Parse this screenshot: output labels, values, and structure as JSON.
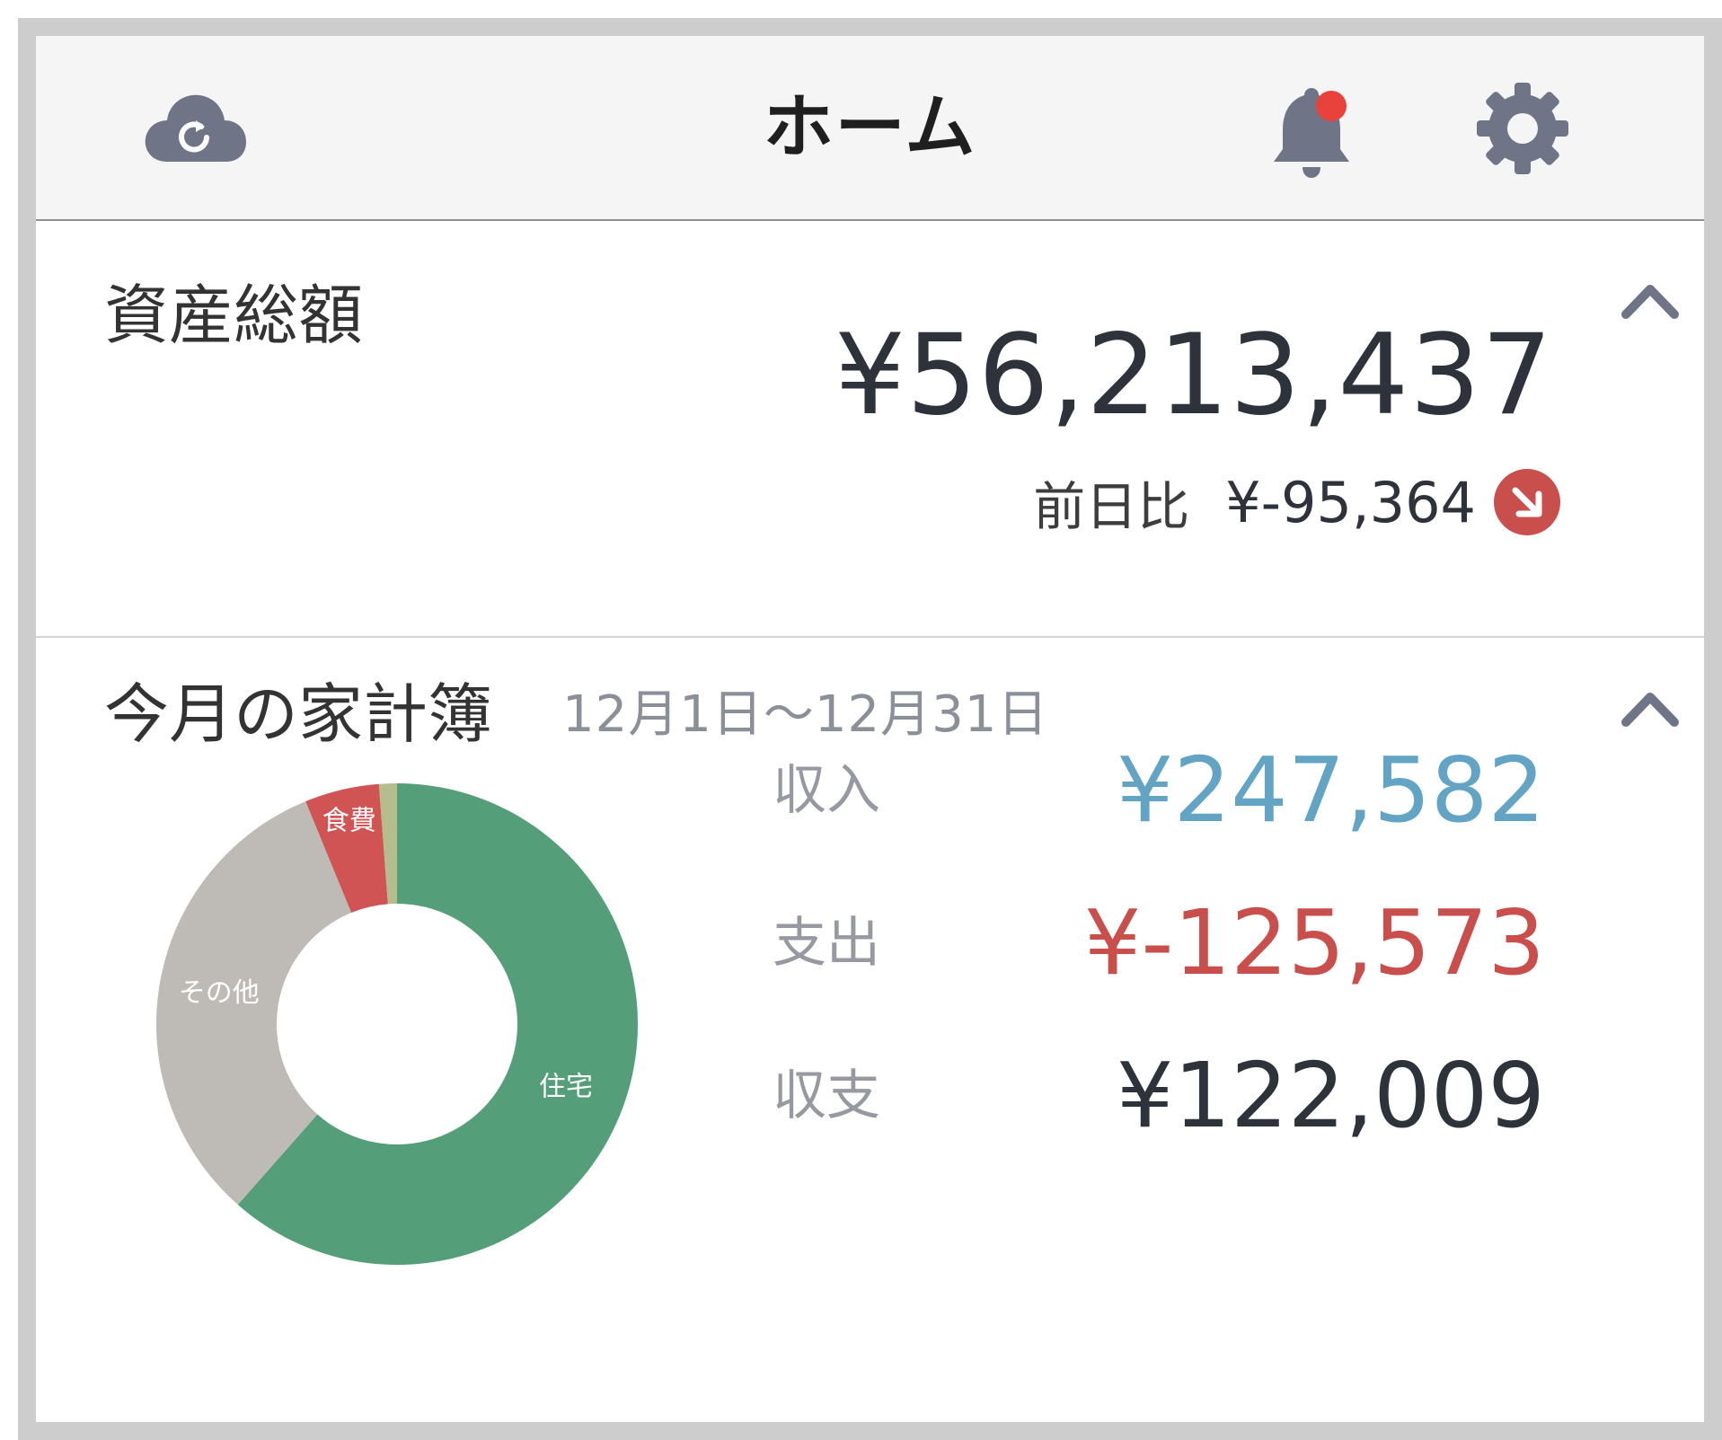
{
  "header": {
    "title": "ホーム",
    "sync_icon": "cloud-sync-icon",
    "bell_icon": "bell-icon",
    "settings_icon": "gear-icon",
    "icon_color": "#6f7587",
    "badge_color": "#e9413b"
  },
  "assets": {
    "label": "資産総額",
    "total": "¥56,213,437",
    "diff_label": "前日比",
    "diff_value": "¥-95,364",
    "trend_icon": "arrow-down-right-icon",
    "trend_color": "#c94f4c"
  },
  "kakeibo": {
    "label": "今月の家計簿",
    "period": "12月1日〜12月31日",
    "income_label": "収入",
    "income_value": "¥247,582",
    "income_color": "#63a4c4",
    "expense_label": "支出",
    "expense_value": "¥-125,573",
    "expense_color": "#c94f4c",
    "balance_label": "収支",
    "balance_value": "¥122,009",
    "balance_color": "#2e333b"
  },
  "chart_data": {
    "type": "pie",
    "inner_radius_ratio": 0.5,
    "slices": [
      {
        "name": "住宅",
        "value": 61.5,
        "color": "#549e79"
      },
      {
        "name": "その他",
        "value": 32.3,
        "color": "#bebab5"
      },
      {
        "name": "食費",
        "value": 5.0,
        "color": "#d15455"
      },
      {
        "name": "",
        "value": 1.2,
        "color": "#b4bd8c"
      }
    ]
  }
}
